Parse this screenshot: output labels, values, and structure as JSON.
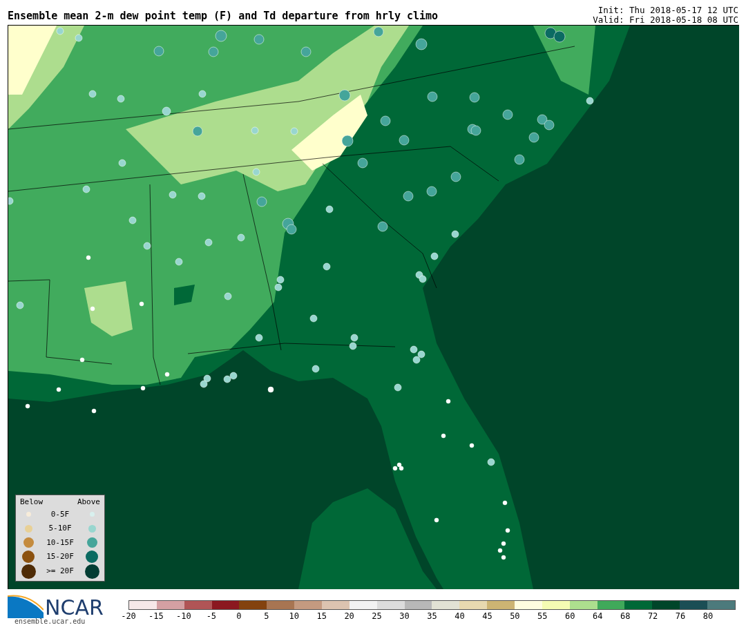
{
  "title": "Ensemble mean 2-m dew point temp (F) and Td departure from hrly climo",
  "init": "Init: Thu 2018-05-17 12 UTC",
  "valid": "Valid: Fri 2018-05-18 08 UTC",
  "legend": {
    "below_heading": "Below",
    "above_heading": "Above",
    "rows": [
      {
        "label": "0-5F",
        "below": {
          "color": "#f7ecd9"
        },
        "above": {
          "color": "#d8f0ee"
        }
      },
      {
        "label": "5-10F",
        "below": {
          "color": "#e8d096"
        },
        "above": {
          "color": "#98d6cf"
        }
      },
      {
        "label": "10-15F",
        "below": {
          "color": "#c48b3e"
        },
        "above": {
          "color": "#45a59a"
        }
      },
      {
        "label": "15-20F",
        "below": {
          "color": "#8c5210"
        },
        "above": {
          "color": "#0b6b62"
        }
      },
      {
        "label": ">= 20F",
        "below": {
          "color": "#4f2c07"
        },
        "above": {
          "color": "#023d33"
        }
      }
    ]
  },
  "logo": {
    "name": "NCAR",
    "url": "ensemble.ucar.edu"
  },
  "colorbar": {
    "segments": [
      {
        "color": "#f6e8e8"
      },
      {
        "color": "#d4a0a3"
      },
      {
        "color": "#b05556"
      },
      {
        "color": "#8b1820"
      },
      {
        "color": "#83420e"
      },
      {
        "color": "#a87552"
      },
      {
        "color": "#c49a80"
      },
      {
        "color": "#dcc3b0"
      },
      {
        "color": "#f2f2f2"
      },
      {
        "color": "#dcdcdc"
      },
      {
        "color": "#b8b8b8"
      },
      {
        "color": "#e2e2d4"
      },
      {
        "color": "#e8d9b0"
      },
      {
        "color": "#cdb473"
      },
      {
        "color": "#fffde0"
      },
      {
        "color": "#f5fbb3"
      },
      {
        "color": "#addf8e"
      },
      {
        "color": "#40a95a"
      },
      {
        "color": "#006837"
      },
      {
        "color": "#004529"
      },
      {
        "color": "#1b4e55"
      },
      {
        "color": "#4c7a7c"
      }
    ],
    "ticks": [
      "-20",
      "-15",
      "-10",
      "-5",
      "0",
      "5",
      "10",
      "15",
      "20",
      "25",
      "30",
      "35",
      "40",
      "45",
      "50",
      "55",
      "60",
      "64",
      "68",
      "72",
      "76",
      "80"
    ]
  }
}
